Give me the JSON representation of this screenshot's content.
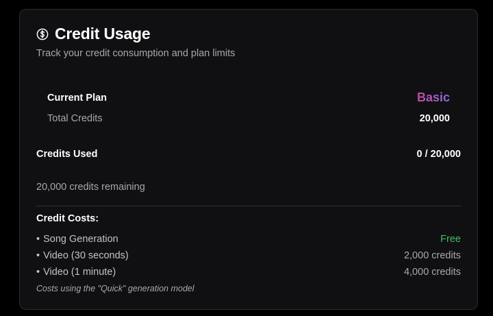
{
  "header": {
    "icon": "dollar-circle-icon",
    "title": "Credit Usage",
    "subtitle": "Track your credit consumption and plan limits"
  },
  "plan": {
    "current_plan_label": "Current Plan",
    "current_plan_value": "Basic",
    "total_credits_label": "Total Credits",
    "total_credits_value": "20,000"
  },
  "usage": {
    "credits_used_label": "Credits Used",
    "credits_used_value": "0 / 20,000",
    "remaining_text": "20,000 credits remaining"
  },
  "costs": {
    "title": "Credit Costs:",
    "items": [
      {
        "name": "Song Generation",
        "value": "Free"
      },
      {
        "name": "Video (30 seconds)",
        "value": "2,000 credits"
      },
      {
        "name": "Video (1 minute)",
        "value": "4,000 credits"
      }
    ],
    "note": "Costs using the \"Quick\" generation model"
  },
  "colors": {
    "background": "#000000",
    "card": "#101012",
    "plan_gradient_start": "#c0479d",
    "plan_gradient_end": "#8b6fe0",
    "free": "#3fbf5f"
  }
}
